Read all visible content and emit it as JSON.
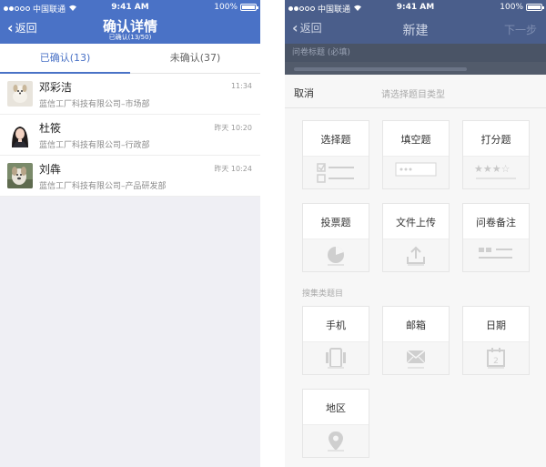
{
  "status": {
    "carrier": "中国联通",
    "time": "9:41 AM",
    "battery": "100%"
  },
  "left": {
    "back": "返回",
    "title": "确认详情",
    "subtitle": "已确认(13/50)",
    "tabs": [
      {
        "label": "已确认(13)",
        "active": true
      },
      {
        "label": "未确认(37)",
        "active": false
      }
    ],
    "rows": [
      {
        "name": "邓彩洁",
        "org": "蓝信工厂科技有限公司–市场部",
        "time": "11:34",
        "avatar": "avatar-dog"
      },
      {
        "name": "杜筱",
        "org": "蓝信工厂科技有限公司–行政部",
        "time": "昨天 10:20",
        "avatar": "avatar-woman"
      },
      {
        "name": "刘犇",
        "org": "蓝信工厂科技有限公司–产品研发部",
        "time": "昨天 10:24",
        "avatar": "avatar-dog"
      }
    ]
  },
  "right": {
    "back": "返回",
    "title": "新建",
    "next": "下一步",
    "field_label": "问卷标题 (必填)",
    "cancel": "取消",
    "hint": "请选择题目类型",
    "section": "搜集类题目",
    "types": [
      {
        "label": "选择题",
        "icon": "checklist-icon"
      },
      {
        "label": "填空题",
        "icon": "text-field-icon"
      },
      {
        "label": "打分题",
        "icon": "stars-icon"
      },
      {
        "label": "投票题",
        "icon": "pie-chart-icon"
      },
      {
        "label": "文件上传",
        "icon": "upload-icon"
      },
      {
        "label": "问卷备注",
        "icon": "note-icon"
      },
      {
        "label": "手机",
        "icon": "phone-icon"
      },
      {
        "label": "邮箱",
        "icon": "mail-icon"
      },
      {
        "label": "日期",
        "icon": "calendar-icon"
      },
      {
        "label": "地区",
        "icon": "location-pin-icon"
      }
    ]
  },
  "colors": {
    "nav": "#4a72c6",
    "nav_dimmed": "#4a5e8b",
    "accent": "#4a72c6",
    "icon_gray": "#cfcfcf"
  }
}
